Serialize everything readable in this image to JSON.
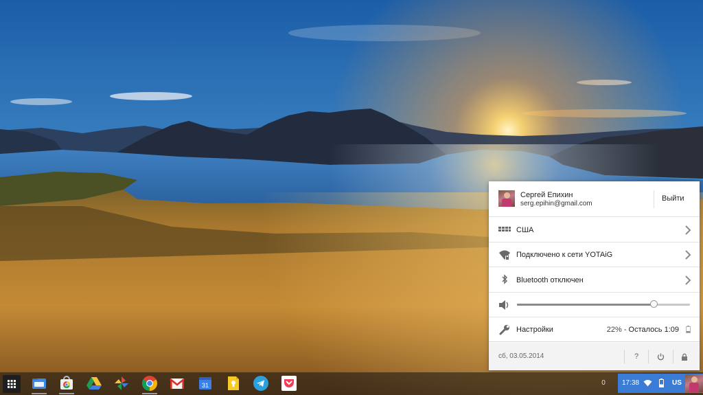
{
  "tray": {
    "user": {
      "name": "Сергей Епихин",
      "email": "serg.epihin@gmail.com",
      "logout_label": "Выйти"
    },
    "rows": {
      "keyboard": {
        "label": "США",
        "icon": "keyboard-icon"
      },
      "network": {
        "label": "Подключено к сети YOTAiG",
        "icon": "wifi-icon"
      },
      "bluetooth": {
        "label": "Bluetooth отключен",
        "icon": "bluetooth-icon"
      },
      "volume": {
        "icon": "volume-icon",
        "level": 0.79
      },
      "settings": {
        "label": "Настройки",
        "icon": "wrench-icon",
        "battery_percent": "22%",
        "battery_sep": " - ",
        "battery_remaining": "Осталось 1:09"
      }
    },
    "footer": {
      "date": "сб, 03.05.2014",
      "help_label": "?",
      "power_icon": "power-icon",
      "lock_icon": "lock-icon"
    }
  },
  "shelf": {
    "apps": [
      "files",
      "chrome-web-store",
      "google-drive",
      "google-photos",
      "chrome",
      "gmail",
      "google-calendar",
      "google-keep",
      "telegram",
      "pocket"
    ],
    "calendar_day": "31",
    "notification_count": "0",
    "status": {
      "time": "17:38",
      "input_method": "US"
    }
  },
  "colors": {
    "status_area": "#3a7bd5",
    "chevron": "#8a8a8a"
  }
}
